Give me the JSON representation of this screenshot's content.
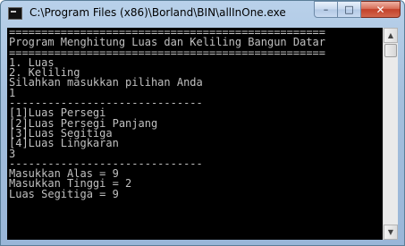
{
  "window": {
    "title": "C:\\Program Files (x86)\\Borland\\BIN\\allInOne.exe",
    "icon": "console-app-icon",
    "buttons": {
      "minimize": "–",
      "maximize": "□",
      "close": "✕"
    }
  },
  "console": {
    "lines": [
      "=================================================",
      "Program Menghitung Luas dan Keliling Bangun Datar",
      "=================================================",
      "1. Luas",
      "2. Keliling",
      "Silahkan masukkan pilihan Anda",
      "1",
      "------------------------------",
      "[1]Luas Persegi",
      "[2]Luas Persegi Panjang",
      "[3]Luas Segitiga",
      "[4]Luas Lingkaran",
      "3",
      "------------------------------",
      "Masukkan Alas = 9",
      "Masukkan Tinggi = 2",
      "Luas Segitiga = 9"
    ]
  },
  "colors": {
    "console_background": "#000000",
    "console_text": "#c0c0c0",
    "close_button": "#c2412a"
  }
}
